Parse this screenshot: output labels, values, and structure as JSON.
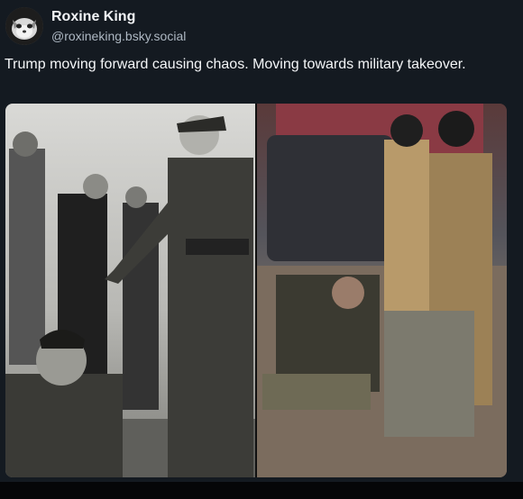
{
  "post": {
    "author": {
      "display_name": "Roxine King",
      "handle": "@roxineking.bsky.social",
      "avatar_icon": "avatar-icon"
    },
    "text": "Trump moving forward causing chaos. Moving towards military takeover.",
    "media": {
      "type": "image",
      "panels": [
        "left-panel-photo",
        "right-panel-photo"
      ]
    }
  },
  "colors": {
    "background": "#141a21",
    "display_name": "#f2f4f7",
    "handle": "#aeb8c3",
    "text": "#f4f6f8"
  }
}
